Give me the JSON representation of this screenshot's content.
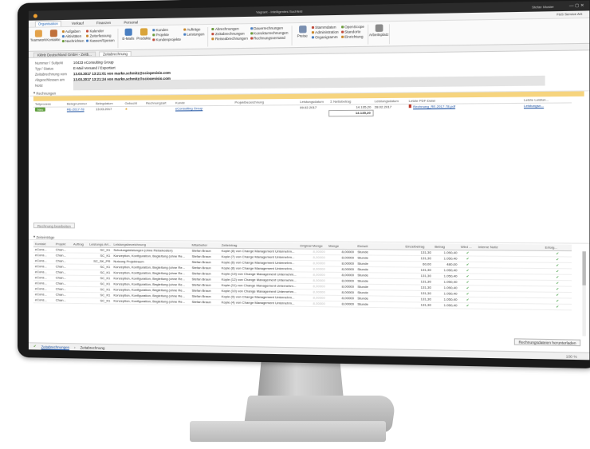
{
  "window": {
    "title": "Vagrant - Intelligentes Suchfeld",
    "user": "Stefan Muster",
    "company": "F&S Service AG"
  },
  "menu": [
    "Organisation",
    "Verkauf",
    "Finanzen",
    "Personal"
  ],
  "ribbon": {
    "groups": [
      {
        "big": [
          {
            "label": "Teamwork",
            "icon": "teamwork-icon"
          },
          {
            "label": "Kontakte",
            "icon": "contacts-icon"
          }
        ],
        "small": [
          "Aufgaben",
          "Aktivitäten",
          "Nachrichten",
          "Kalender",
          "Zeiterfassung",
          "Kassen/Spesen"
        ]
      },
      {
        "big": [
          {
            "label": "E-Mails",
            "icon": "email-icon"
          },
          {
            "label": "Produkte",
            "icon": "products-icon"
          }
        ],
        "small": [
          "Kunden",
          "Projekte",
          "Kundenprojekte",
          "Aufträge",
          "Leistungen"
        ]
      },
      {
        "big": [],
        "small": [
          "Abrechnungen",
          "Zeitabrechnungen",
          "Reiseabrechnungen",
          "Dauerrechnungen",
          "Korrekturrechnungen",
          "Rechnungsversand"
        ]
      },
      {
        "big": [
          {
            "label": "Preise",
            "icon": "price-icon"
          }
        ],
        "small": [
          "Stammdaten",
          "Administration",
          "Organigramm",
          "OpenScope",
          "Standorte",
          "Einrichtung"
        ]
      },
      {
        "big": [
          {
            "label": "Arbeitsplatz",
            "icon": "workplace-icon"
          }
        ],
        "small": []
      }
    ]
  },
  "tabs": [
    "Kklnb Deutschland GmbH - Zeitb...",
    "Zeitabrechnung"
  ],
  "header": {
    "fields": [
      {
        "label": "Nummer / Subjekt",
        "value": "10433 eConsulting Group"
      },
      {
        "label": "Typ / Status",
        "value": "E-Mail Versand / Exportiert"
      },
      {
        "label": "Zeitabrechnung vom",
        "value": "13.03.2017 13:21:01 von marko.schmitz@sciopevisio.com"
      },
      {
        "label": "Abgeschlossen am",
        "value": "13.03.2017 13:21:24 von marko.schmitz@sciopevisio.com"
      },
      {
        "label": "Notiz",
        "value": ""
      }
    ]
  },
  "invoices": {
    "section": "Rechnungen",
    "columns": [
      "Teilprozess",
      "Belegnummer",
      "Belegdatum",
      "Gebucht",
      "Rechnungsart",
      "Kunde",
      "Projektbezeichnung",
      "Leistungsdatum",
      "Σ Nettobetrag",
      "Leistungsdatum",
      "Letzte PDF-Datei",
      "Letzte Leistun..."
    ],
    "rows": [
      {
        "status": "Neu",
        "number": "RE-2017-78",
        "date": "13.03.2017",
        "booked": "★",
        "type": "",
        "customer": "eConsulting Group",
        "project": "",
        "service_date": "09.02.2017",
        "net": "14.135,20",
        "service_date2": "28.02.2017",
        "pdf": "Rechnung_RE-2017-78.pdf",
        "last": "Leistungsn..."
      }
    ],
    "total": "14.135,20",
    "edit_button": "Rechnung bearbeiten"
  },
  "entries": {
    "section": "Zeiteinträge",
    "columns": [
      "Kontakt",
      "Projekt",
      "Auftrag",
      "Leistungs-Art...",
      "Leistungsbezeichnung",
      "Mitarbeiter",
      "Zeiteintrag",
      "Original Menge",
      "Menge",
      "Einheit",
      "Einzelbetrag",
      "Betrag",
      "Wird ...",
      "Interne Notiz",
      "Erfolg..."
    ],
    "rows": [
      {
        "contact": "eCons...",
        "project": "Chan...",
        "type": "SC_K1",
        "desc": "Schulungsleistungen (ohne Reisekosten)",
        "emp": "Stefan Braun",
        "entry": "Kopie (8) von Change Management Unternehm...",
        "orig": "8,00000",
        "qty": "8,00000",
        "unit": "Stunde",
        "price": "131,30",
        "amount": "1.050,40",
        "check": "✔"
      },
      {
        "contact": "eCons...",
        "project": "Chan...",
        "type": "SC_K1",
        "desc": "Konzeption, Konfiguration, Begleitung (ohne Re...",
        "emp": "Stefan Braun",
        "entry": "Kopie (7) von Change Management Unternehm...",
        "orig": "8,00000",
        "qty": "8,00000",
        "unit": "Stunde",
        "price": "131,30",
        "amount": "1.050,40",
        "check": "✔"
      },
      {
        "contact": "eCons...",
        "project": "Chan...",
        "type": "SC_SK_PR",
        "desc": "Nutzung Projektraum",
        "emp": "Stefan Braun",
        "entry": "Kopie (6) von Change Management Unternehm...",
        "orig": "8,00000",
        "qty": "8,00000",
        "unit": "Stunde",
        "price": "60,00",
        "amount": "480,00",
        "check": "✔"
      },
      {
        "contact": "eCons...",
        "project": "Chan...",
        "type": "SC_K1",
        "desc": "Konzeption, Konfiguration, Begleitung (ohne Re...",
        "emp": "Stefan Braun",
        "entry": "Kopie (8) von Change Management Unternehm...",
        "orig": "8,00000",
        "qty": "8,00000",
        "unit": "Stunde",
        "price": "131,30",
        "amount": "1.050,40",
        "check": "✔"
      },
      {
        "contact": "eCons...",
        "project": "Chan...",
        "type": "SC_K1",
        "desc": "Konzeption, Konfiguration, Begleitung (ohne Re...",
        "emp": "Stefan Braun",
        "entry": "Kopie (13) von Change Management Unternehm...",
        "orig": "8,00000",
        "qty": "8,00000",
        "unit": "Stunde",
        "price": "131,30",
        "amount": "1.050,40",
        "check": "✔"
      },
      {
        "contact": "eCons...",
        "project": "Chan...",
        "type": "SC_K1",
        "desc": "Konzeption, Konfiguration, Begleitung (ohne Re...",
        "emp": "Stefan Braun",
        "entry": "Kopie (12) von Change Management Unternehm...",
        "orig": "8,00000",
        "qty": "8,00000",
        "unit": "Stunde",
        "price": "131,30",
        "amount": "1.050,40",
        "check": "✔"
      },
      {
        "contact": "eCons...",
        "project": "Chan...",
        "type": "SC_K1",
        "desc": "Konzeption, Konfiguration, Begleitung (ohne Re...",
        "emp": "Stefan Braun",
        "entry": "Kopie (11) von Change Management Unternehm...",
        "orig": "8,00000",
        "qty": "8,00000",
        "unit": "Stunde",
        "price": "131,30",
        "amount": "1.050,40",
        "check": "✔"
      },
      {
        "contact": "eCons...",
        "project": "Chan...",
        "type": "SC_K1",
        "desc": "Konzeption, Konfiguration, Begleitung (ohne Re...",
        "emp": "Stefan Braun",
        "entry": "Kopie (10) von Change Management Unternehm...",
        "orig": "8,00000",
        "qty": "8,00000",
        "unit": "Stunde",
        "price": "131,30",
        "amount": "1.050,40",
        "check": "✔"
      },
      {
        "contact": "eCons...",
        "project": "Chan...",
        "type": "SC_K1",
        "desc": "Konzeption, Konfiguration, Begleitung (ohne Re...",
        "emp": "Stefan Braun",
        "entry": "Kopie (9) von Change Management Unternehm...",
        "orig": "8,00000",
        "qty": "8,00000",
        "unit": "Stunde",
        "price": "131,30",
        "amount": "1.050,40",
        "check": "✔"
      },
      {
        "contact": "eCons...",
        "project": "Chan...",
        "type": "SC_K1",
        "desc": "Konzeption, Konfiguration, Begleitung (ohne Re...",
        "emp": "Stefan Braun",
        "entry": "Kopie (4) von Change Management Unternehm...",
        "orig": "8,00000",
        "qty": "8,00000",
        "unit": "Stunde",
        "price": "131,30",
        "amount": "1.050,40",
        "check": "✔"
      }
    ],
    "download_button": "Rechnungsdateien herunterladen"
  },
  "status": {
    "breadcrumb": [
      "Zeitabrechnungen",
      "Zeitabrechnung"
    ],
    "zoom": "100 %"
  },
  "colors": {
    "accent": "#f6d47e",
    "badge": "#5e9e3c",
    "link": "#1a4fa0"
  }
}
